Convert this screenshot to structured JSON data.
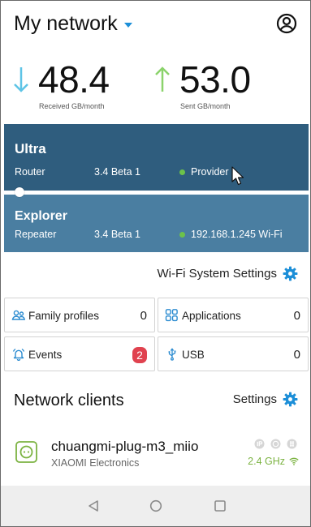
{
  "header": {
    "title": "My network"
  },
  "stats": {
    "received": {
      "value": "48.4",
      "label": "Received GB/month"
    },
    "sent": {
      "value": "53.0",
      "label": "Sent GB/month"
    }
  },
  "devices": [
    {
      "name": "Ultra",
      "role": "Router",
      "version": "3.4 Beta 1",
      "status": "Provider"
    },
    {
      "name": "Explorer",
      "role": "Repeater",
      "version": "3.4 Beta 1",
      "status": "192.168.1.245 Wi-Fi"
    }
  ],
  "wifi_settings": {
    "label": "Wi-Fi System Settings"
  },
  "tiles": [
    {
      "label": "Family profiles",
      "count": "0"
    },
    {
      "label": "Applications",
      "count": "0"
    },
    {
      "label": "Events",
      "count": "2"
    },
    {
      "label": "USB",
      "count": "0"
    }
  ],
  "clients": {
    "title": "Network clients",
    "settings_label": "Settings",
    "items": [
      {
        "name": "chuangmi-plug-m3_miio",
        "vendor": "XIAOMI Electronics",
        "band": "2.4 GHz"
      }
    ]
  },
  "colors": {
    "accent": "#1d8fd8",
    "received_arrow": "#5ec4e6",
    "sent_arrow": "#8bd36b",
    "router_card": "#2f5d7e",
    "repeater_card": "#4a7ea1",
    "online": "#6cc24a",
    "badge": "#e0424f",
    "band": "#7cb342"
  },
  "icons": {
    "account": "account-circle-icon",
    "gear": "gear-icon",
    "family": "family-profiles-icon",
    "applications": "applications-grid-icon",
    "events": "bell-icon",
    "usb": "usb-icon",
    "client": "smart-plug-icon",
    "wifi": "wifi-signal-icon"
  }
}
